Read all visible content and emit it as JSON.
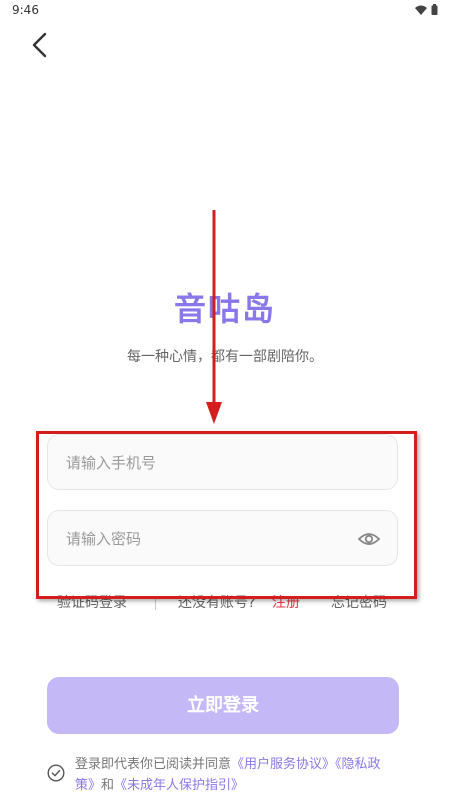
{
  "status_bar": {
    "time": "9:46"
  },
  "app": {
    "title": "音咕岛",
    "slogan": "每一种心情，都有一部剧陪你。"
  },
  "form": {
    "phone_placeholder": "请输入手机号",
    "password_placeholder": "请输入密码"
  },
  "links": {
    "code_login": "验证码登录",
    "no_account": "还没有账号?",
    "register": "注册",
    "forgot_password": "忘记密码"
  },
  "login_button": "立即登录",
  "agreement": {
    "prefix": "登录即代表你已阅读并同意",
    "user_agreement": "《用户服务协议》",
    "privacy_policy": "《隐私政策》",
    "and": "和",
    "minor_guide": "《未成年人保护指引》"
  },
  "colors": {
    "brand": "#8a78ea",
    "button_disabled": "#c4b8f6",
    "register": "#e8374a",
    "annotation": "#d41e1e"
  }
}
